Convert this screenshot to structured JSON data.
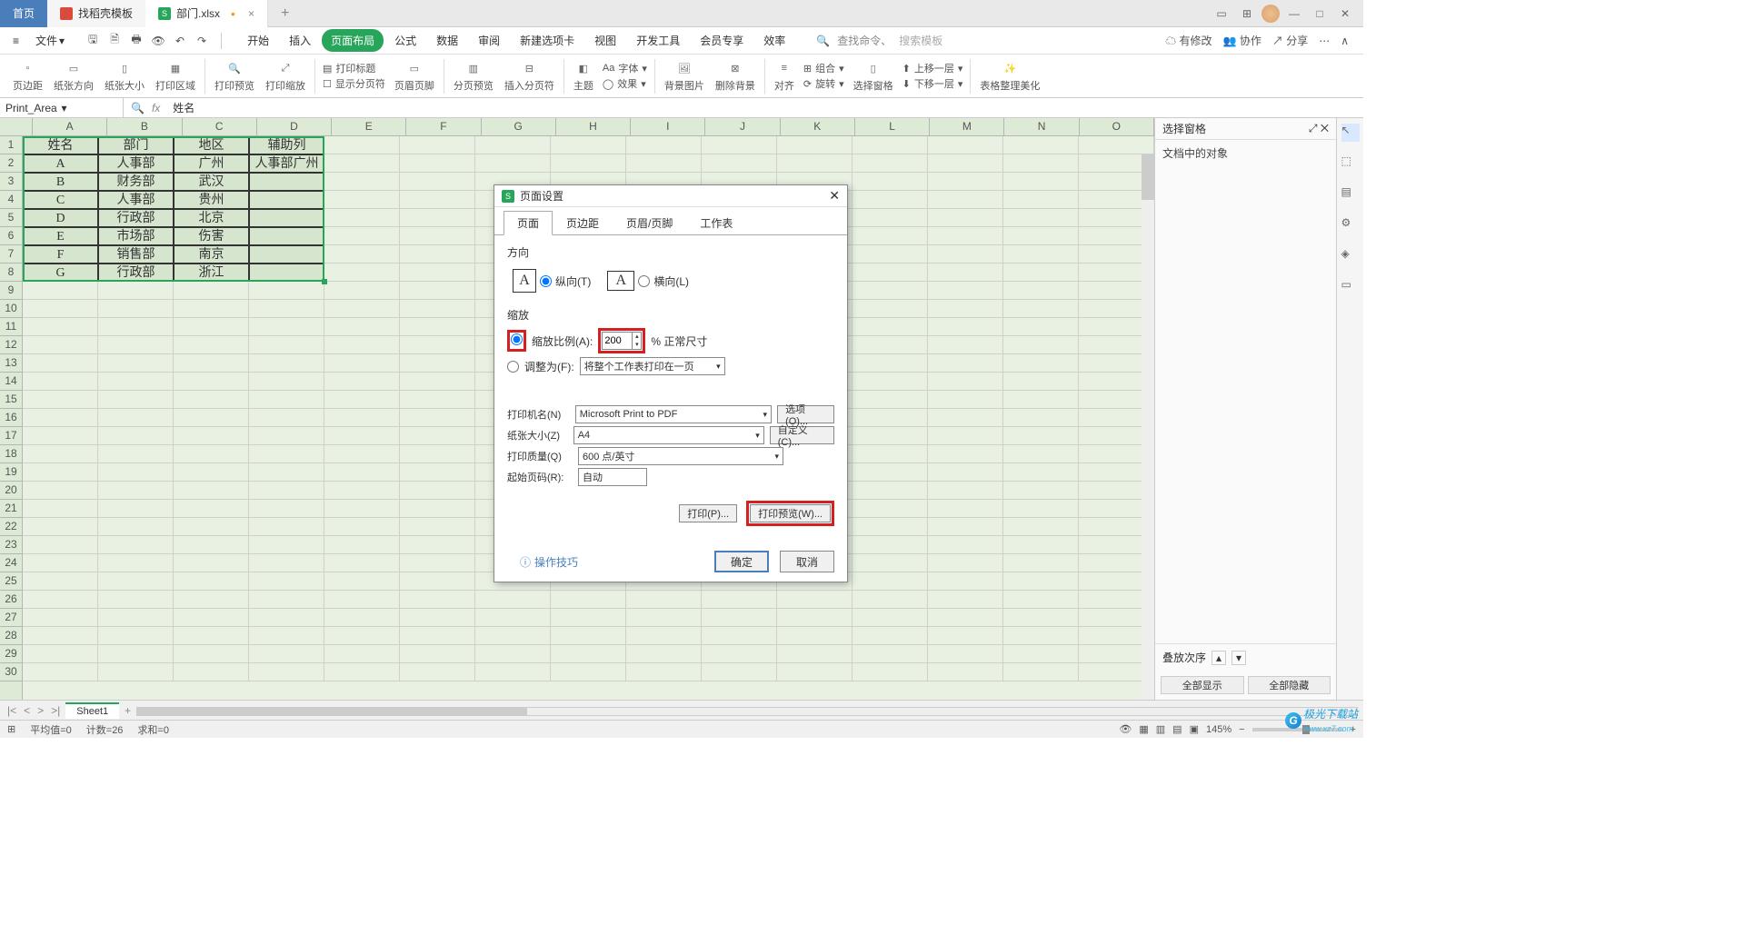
{
  "titlebar": {
    "home_tab": "首页",
    "template_tab": "找稻壳模板",
    "file_tab": "部门.xlsx"
  },
  "menurow": {
    "file": "文件",
    "tabs": [
      "开始",
      "插入",
      "页面布局",
      "公式",
      "数据",
      "审阅",
      "新建选项卡",
      "视图",
      "开发工具",
      "会员专享",
      "效率"
    ],
    "active_index": 2,
    "search_hint": "查找命令、",
    "template_hint": "搜索模板",
    "right": {
      "pending": "有修改",
      "collab": "协作",
      "share": "分享"
    }
  },
  "ribbon": {
    "margins": "页边距",
    "orientation": "纸张方向",
    "size": "纸张大小",
    "print_area": "打印区域",
    "preview": "打印预览",
    "scaling": "打印缩放",
    "print_titles": "打印标题",
    "show_pagebreaks": "显示分页符",
    "header_footer": "页眉页脚",
    "pagebreak": "分页预览",
    "insert_break": "插入分页符",
    "theme": "主题",
    "fonts": "字体",
    "effects": "效果",
    "bg": "背景图片",
    "del_bg": "删除背景",
    "align": "对齐",
    "group": "组合",
    "rotate": "旋转",
    "sel_pane": "选择窗格",
    "fwd": "上移一层",
    "back": "下移一层",
    "beautify": "表格整理美化"
  },
  "formula": {
    "name_box": "Print_Area",
    "value": "姓名"
  },
  "columns": [
    "A",
    "B",
    "C",
    "D",
    "E",
    "F",
    "G",
    "H",
    "I",
    "J",
    "K",
    "L",
    "M",
    "N",
    "O"
  ],
  "table": {
    "headers": [
      "姓名",
      "部门",
      "地区",
      "辅助列"
    ],
    "rows": [
      [
        "A",
        "人事部",
        "广州",
        "人事部广州"
      ],
      [
        "B",
        "财务部",
        "武汉",
        ""
      ],
      [
        "C",
        "人事部",
        "贵州",
        ""
      ],
      [
        "D",
        "行政部",
        "北京",
        ""
      ],
      [
        "E",
        "市场部",
        "伤害",
        ""
      ],
      [
        "F",
        "销售部",
        "南京",
        ""
      ],
      [
        "G",
        "行政部",
        "浙江",
        ""
      ]
    ]
  },
  "dialog": {
    "title": "页面设置",
    "tabs": [
      "页面",
      "页边距",
      "页眉/页脚",
      "工作表"
    ],
    "direction_label": "方向",
    "portrait": "纵向(T)",
    "landscape": "横向(L)",
    "scale_label": "缩放",
    "scale_ratio": "缩放比例(A):",
    "scale_value": "200",
    "normal": "% 正常尺寸",
    "fit_to": "调整为(F):",
    "fit_value": "将整个工作表打印在一页",
    "printer": "打印机名(N)",
    "printer_value": "Microsoft Print to PDF",
    "options": "选项(O)...",
    "paper": "纸张大小(Z)",
    "paper_value": "A4",
    "custom": "自定义(C)...",
    "quality": "打印质量(Q)",
    "quality_value": "600 点/英寸",
    "start_page": "起始页码(R):",
    "start_value": "自动",
    "print_btn": "打印(P)...",
    "preview_btn": "打印预览(W)...",
    "tips": "操作技巧",
    "ok": "确定",
    "cancel": "取消"
  },
  "right_panel": {
    "title": "选择窗格",
    "subtitle": "文档中的对象",
    "stack": "叠放次序",
    "show_all": "全部显示",
    "hide_all": "全部隐藏"
  },
  "sheet": {
    "name": "Sheet1"
  },
  "status": {
    "avg": "平均值=0",
    "count": "计数=26",
    "sum": "求和=0",
    "zoom": "145%"
  },
  "watermark": {
    "text": "极光下载站",
    "url": "www.xz7.com"
  }
}
